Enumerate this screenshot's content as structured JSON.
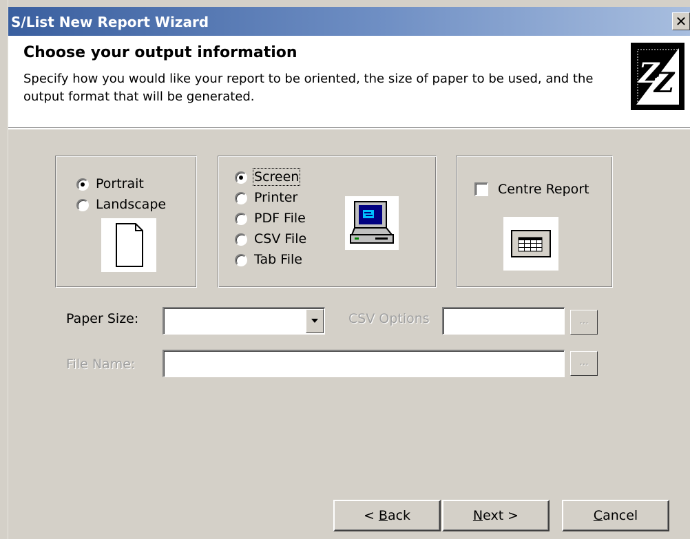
{
  "window": {
    "title": "S/List New Report Wizard",
    "close_glyph": "✕"
  },
  "header": {
    "heading": "Choose your output information",
    "description": "Specify how you would like your report to be oriented, the size of paper to be used, and the output format that will be generated.",
    "logo_icon": "zz-logo-icon"
  },
  "orientation": {
    "options": [
      {
        "label": "Portrait",
        "checked": true
      },
      {
        "label": "Landscape",
        "checked": false
      }
    ],
    "icon": "page-portrait-icon"
  },
  "output": {
    "options": [
      {
        "label": "Screen",
        "checked": true
      },
      {
        "label": "Printer",
        "checked": false
      },
      {
        "label": "PDF File",
        "checked": false
      },
      {
        "label": "CSV File",
        "checked": false
      },
      {
        "label": "Tab File",
        "checked": false
      }
    ],
    "icon": "computer-screen-icon"
  },
  "centre": {
    "label": "Centre Report",
    "checked": false,
    "icon": "table-grid-icon"
  },
  "fields": {
    "paper_size_label": "Paper Size:",
    "paper_size_value": "",
    "csv_options_label": "CSV Options",
    "csv_options_value": "",
    "file_name_label": "File Name:",
    "file_name_value": "",
    "ellipsis": "..."
  },
  "buttons": {
    "back": {
      "prefix": "< ",
      "mnemonic": "B",
      "rest": "ack"
    },
    "next": {
      "mnemonic": "N",
      "rest": "ext >"
    },
    "cancel": {
      "mnemonic": "C",
      "rest": "ancel"
    }
  },
  "colors": {
    "titlebar_start": "#3a5f9f",
    "titlebar_end": "#a8bedf",
    "dialog_face": "#d4d0c8"
  }
}
